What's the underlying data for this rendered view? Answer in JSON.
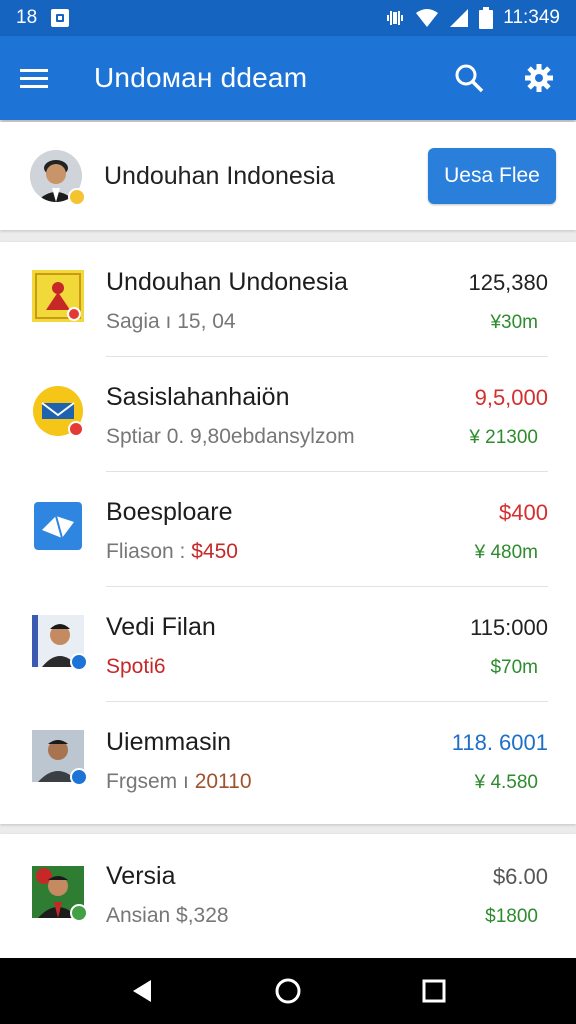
{
  "status_bar": {
    "time_left": "18",
    "time_right": "11:349",
    "bg_color": "#1565c0"
  },
  "app_bar": {
    "title": "Undoман ddeam",
    "menu_icon": "menu-icon",
    "search_icon": "search-icon",
    "settings_icon": "gear-icon",
    "color": "#1e74d6"
  },
  "profile": {
    "name": "Undouhan Indonesia",
    "button_label": "Uesa Flee"
  },
  "items": [
    {
      "title": "Undouhan Undonesia",
      "sub": "Sagia ı 15, 04",
      "amount": "125,380",
      "sub_amount": "¥30m",
      "amount_color": "#222222",
      "sub_color": "#2e8b2e",
      "sub_text_color": "#777777",
      "icon": "stamp-icon"
    },
    {
      "title": "Sasislahanhaiön",
      "sub": "Sptiar 0. 9,80ebdansylzom",
      "amount": "9,5,000",
      "sub_amount": "¥ 21300",
      "amount_color": "#d32f2f",
      "sub_color": "#2e8b2e",
      "sub_text_color": "#777777",
      "icon": "mail-icon"
    },
    {
      "title": "Boesploare",
      "sub_prefix": "Fliason :",
      "sub_value": "$450",
      "amount": "$400",
      "sub_amount": "¥ 480m",
      "amount_color": "#d32f2f",
      "sub_color": "#2e8b2e",
      "sub_text_color": "#777777",
      "sub_value_color": "#c62828",
      "icon": "envelope-icon"
    },
    {
      "title": "Vedi Filan",
      "sub": "Spoti6",
      "amount": "115:000",
      "sub_amount": "$70m",
      "amount_color": "#222222",
      "sub_color": "#2e8b2e",
      "sub_text_color": "#c62828",
      "icon": "avatar-icon"
    },
    {
      "title": "Uiemmasin",
      "sub_prefix": "Frgsem ı",
      "sub_value": "20110",
      "amount": "118. 6001",
      "sub_amount": "¥ 4.580",
      "amount_color": "#1e6fc8",
      "sub_color": "#2e8b2e",
      "sub_text_color": "#777777",
      "sub_value_color": "#a0522d",
      "icon": "avatar-icon"
    }
  ],
  "last_item": {
    "title": "Versia",
    "sub": "Ansian $,328",
    "amount": "$6.00",
    "sub_amount": "$1800",
    "amount_color": "#555555",
    "sub_color": "#2e8b2e",
    "icon": "avatar-icon"
  },
  "nav": {
    "back_icon": "back-icon",
    "home_icon": "home-icon",
    "recent_icon": "recent-apps-icon"
  }
}
